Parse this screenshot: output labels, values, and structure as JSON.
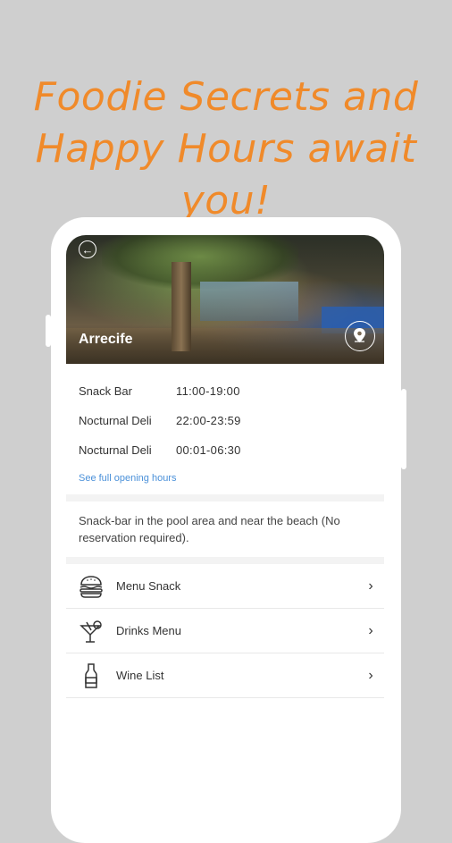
{
  "headline": {
    "line1": "Foodie Secrets and",
    "line2": "Happy Hours await you!"
  },
  "venue": {
    "title": "Arrecife",
    "back_icon": "back-arrow-icon",
    "map_icon": "map-pin-icon"
  },
  "hours": [
    {
      "name": "Snack Bar",
      "time": "11:00-19:00"
    },
    {
      "name": "Nocturnal Deli",
      "time": "22:00-23:59"
    },
    {
      "name": "Nocturnal Deli",
      "time": "00:01-06:30"
    }
  ],
  "hours_link": "See full opening hours",
  "description": "Snack-bar in the pool area and near the beach (No reservation required).",
  "menus": [
    {
      "label": "Menu Snack",
      "icon": "burger-icon"
    },
    {
      "label": "Drinks Menu",
      "icon": "cocktail-icon"
    },
    {
      "label": "Wine List",
      "icon": "wine-bottle-icon"
    }
  ],
  "colors": {
    "headline": "#f08a2a",
    "link": "#4a90d9",
    "background": "#cfcfcf"
  }
}
